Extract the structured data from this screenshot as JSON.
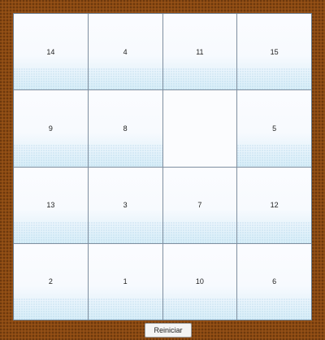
{
  "puzzle": {
    "tiles": [
      "14",
      "4",
      "11",
      "15",
      "9",
      "8",
      "",
      "5",
      "13",
      "3",
      "7",
      "12",
      "2",
      "1",
      "10",
      "6"
    ]
  },
  "controls": {
    "reset_label": "Reiniciar"
  }
}
